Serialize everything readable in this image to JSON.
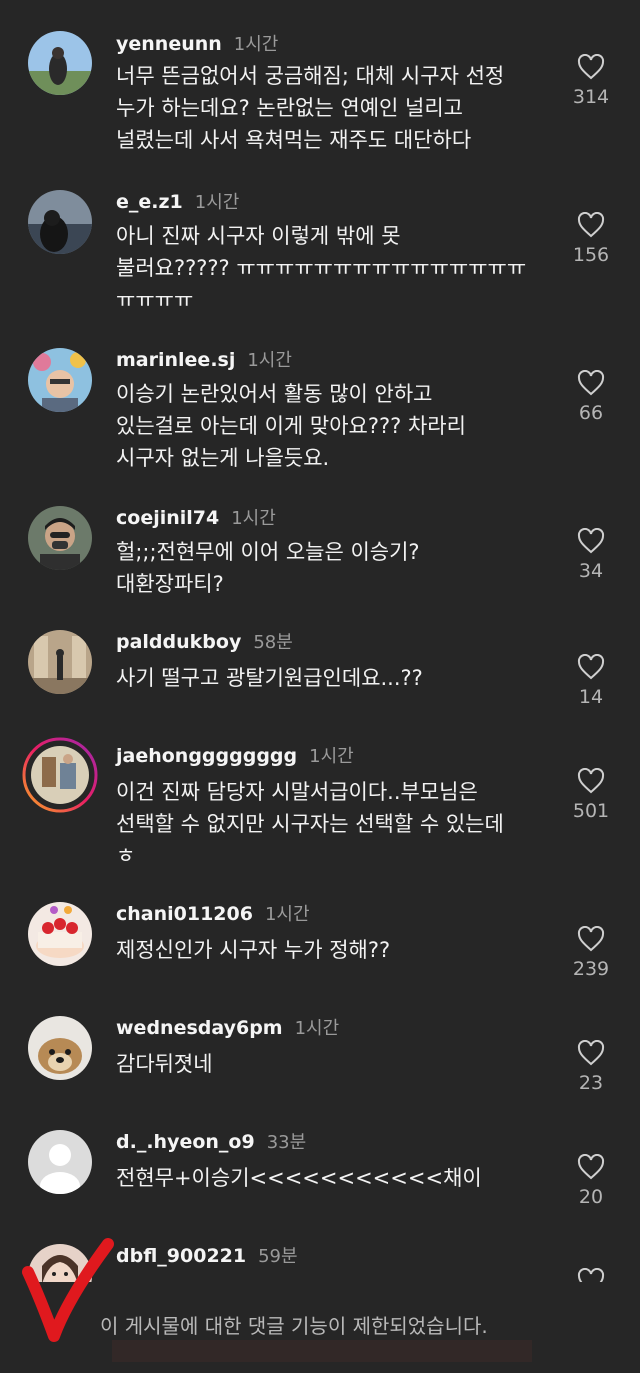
{
  "comments": [
    {
      "username": "yenneunn",
      "time": "1시간",
      "lines": [
        "너무 뜬금없어서 궁금해짐; 대체 시구자 선정",
        "누가 하는데요? 논란없는 연예인 널리고",
        "널렸는데 사서 욕쳐먹는 재주도 대단하다"
      ],
      "likes": "314"
    },
    {
      "username": "e_e.z1",
      "time": "1시간",
      "lines": [
        "아니 진짜 시구자 이렇게 밖에 못",
        "불러요????? ㅠㅠㅠㅠㅠㅠㅠㅠㅠㅠㅠㅠㅠㅠㅠ",
        "ㅠㅠㅠㅠ"
      ],
      "likes": "156"
    },
    {
      "username": "marinlee.sj",
      "time": "1시간",
      "lines": [
        "이승기 논란있어서 활동 많이 안하고",
        "있는걸로 아는데 이게 맞아요??? 차라리",
        "시구자 없는게 나을듯요."
      ],
      "likes": "66"
    },
    {
      "username": "coejinil74",
      "time": "1시간",
      "lines": [
        "헐;;;전현무에 이어 오늘은 이승기?",
        "대환장파티?"
      ],
      "likes": "34"
    },
    {
      "username": "palddukboy",
      "time": "58분",
      "lines": [
        "사기 떨구고 광탈기원급인데요...??"
      ],
      "likes": "14"
    },
    {
      "username": "jaehongggggggg",
      "time": "1시간",
      "lines": [
        "이건 진짜 담당자 시말서급이다..부모님은",
        "선택할 수 없지만 시구자는 선택할 수 있는데",
        "ㅎ"
      ],
      "likes": "501"
    },
    {
      "username": "chani011206",
      "time": "1시간",
      "lines": [
        "제정신인가 시구자 누가 정해??"
      ],
      "likes": "239"
    },
    {
      "username": "wednesday6pm",
      "time": "1시간",
      "lines": [
        "감다뒤졋네"
      ],
      "likes": "23"
    },
    {
      "username": "d._.hyeon_o9",
      "time": "33분",
      "lines": [
        "전현무+이승기<<<<<<<<<<<채이"
      ],
      "likes": "20"
    },
    {
      "username": "dbfl_900221",
      "time": "59분",
      "lines": [],
      "likes": ""
    }
  ],
  "footer": {
    "restricted_text": "이 게시물에 대한 댓글 기능이 제한되었습니다."
  },
  "colors": {
    "background": "#262626",
    "text": "#f2f2f2",
    "muted": "#9a9a9a",
    "annotation_red": "#e0191e"
  }
}
